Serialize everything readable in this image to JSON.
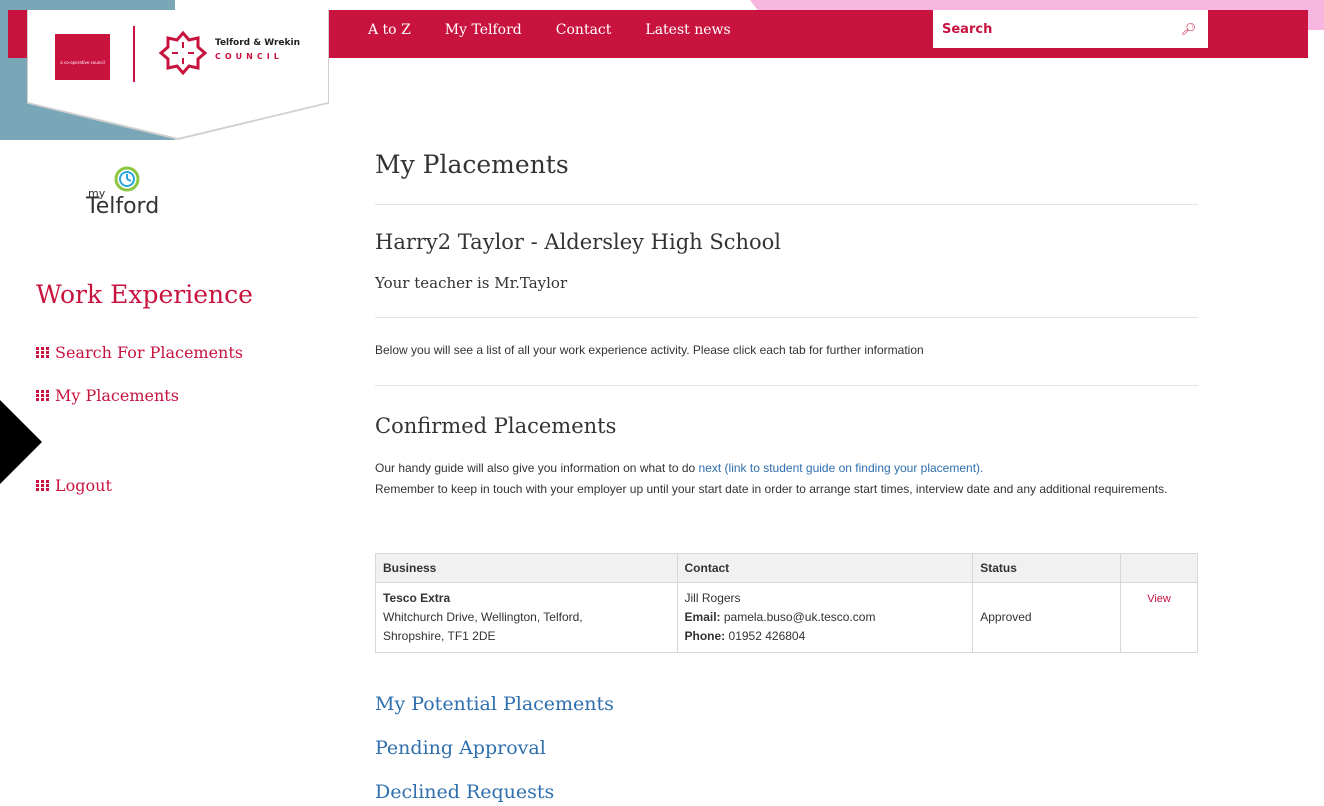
{
  "header": {
    "nav": [
      "A to Z",
      "My Telford",
      "Contact",
      "Latest news"
    ],
    "search_placeholder": "Search",
    "logo": {
      "coop_text": "a co-operative council",
      "council_name": "Telford & Wrekin",
      "council_word": "COUNCIL"
    }
  },
  "mytelford_logo": {
    "my": "my",
    "word": "Telford"
  },
  "sidebar": {
    "title": "Work Experience",
    "links": [
      "Search For Placements",
      "My Placements",
      "Logout"
    ]
  },
  "main": {
    "page_title": "My Placements",
    "student_heading": "Harry2 Taylor - Aldersley High School",
    "teacher_line": "Your teacher is Mr.Taylor",
    "intro": "Below you will see a list of all your work experience activity. Please click each tab for further information",
    "confirmed": {
      "heading": "Confirmed Placements",
      "guide_before": "Our handy guide will also give you information on what to do ",
      "guide_link": "next (link to student guide on finding your placement).",
      "guide_after": "Remember to keep in touch with your employer up until your start date in order to arrange start times, interview date and any additional requirements.",
      "table": {
        "headers": [
          "Business",
          "Contact",
          "Status",
          ""
        ],
        "rows": [
          {
            "business_name": "Tesco Extra",
            "business_address_1": "Whitchurch Drive, Wellington, Telford,",
            "business_address_2": "Shropshire, TF1 2DE",
            "contact_name": "Jill Rogers",
            "email_label": "Email:",
            "email": "pamela.buso@uk.tesco.com",
            "phone_label": "Phone:",
            "phone": "01952 426804",
            "status": "Approved",
            "action": "View"
          }
        ]
      }
    },
    "sections": [
      "My Potential Placements",
      "Pending Approval",
      "Declined Requests"
    ]
  },
  "colors": {
    "brand": "#c8133f",
    "link": "#2f6fae",
    "teal_corner": "#7aa7b8",
    "pink_corner": "#f6b6e0"
  }
}
